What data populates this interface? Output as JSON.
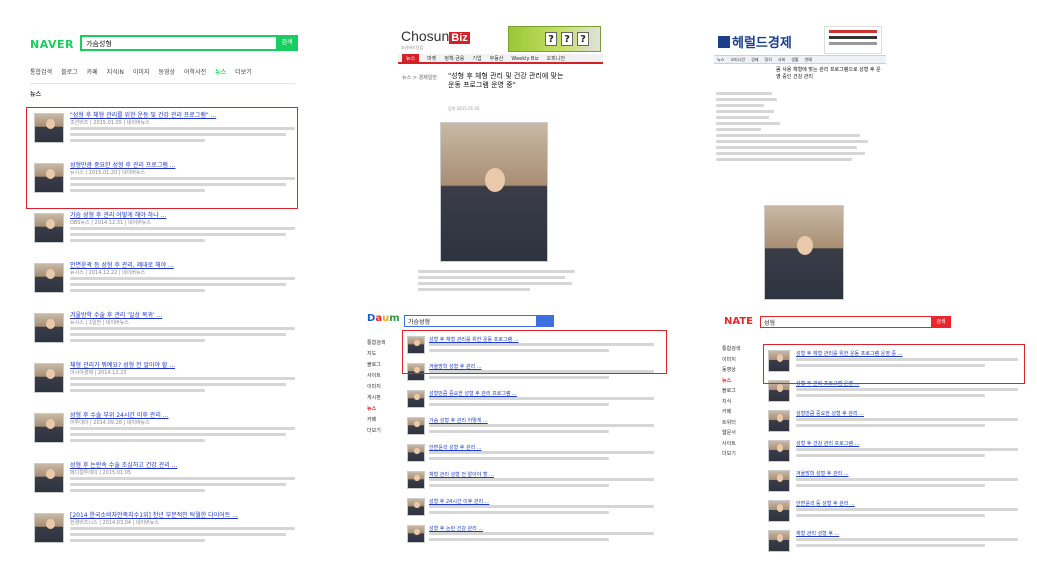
{
  "naver": {
    "logo": "NAVER",
    "search_value": "가슴성형",
    "search_button": "검색",
    "tabs": [
      "통합검색",
      "블로그",
      "카페",
      "지식iN",
      "이미지",
      "동영상",
      "어학사전",
      "뉴스",
      "더보기"
    ],
    "active_tab": "뉴스",
    "section_label": "뉴스",
    "results": [
      {
        "title": "\"성형 후 체형 관리를 위한 운동 및 건강 관리 프로그램\" ...",
        "meta": "조선비즈 | 2015.01.05 | 네이버뉴스"
      },
      {
        "title": "성형만큼 중요한 성형 후 관리 프로그램 ...",
        "meta": "뉴시스 | 2015.01.20 | 네이버뉴스"
      },
      {
        "title": "가슴 성형 후 관리 어떻게 해야 하나 ...",
        "meta": "OBS뉴스 | 2014.12.31 | 네이버뉴스"
      },
      {
        "title": "안면윤곽 등 성형 후 관리, 제대로 해야 ...",
        "meta": "뉴시스 | 2014.12.22 | 네이버뉴스"
      },
      {
        "title": "겨울방학 수술 후 관리 '일상 복귀' ...",
        "meta": "뉴시스 | 1일전 | 네이버뉴스"
      },
      {
        "title": "체형 관리가 뭐예요? 성형 전 알아야 할 ...",
        "meta": "아시아경제 | 2014.12.23"
      },
      {
        "title": "성형 후 수술 부위 24시간 이후 관리 ...",
        "meta": "이투데이 | 2014.09.28 | 네이버뉴스"
      },
      {
        "title": "성형 후 논란속 수술 조심하고 건강 관리 ...",
        "meta": "메디컬투데이 | 2015.01.05"
      },
      {
        "title": "[2014 한국소비자만족지수1위] 천년 부분적인 탁월한 다이어트 ...",
        "meta": "한경비즈니스 | 2014.03.04 | 네이버뉴스"
      }
    ]
  },
  "chosun": {
    "logo_prefix": "Chosun",
    "logo_suffix": "Biz",
    "logo_sub": "조선비즈닷컴",
    "ad_marks": [
      "?",
      "?",
      "?"
    ],
    "nav": [
      "뉴스",
      "마켓",
      "정책·금융",
      "기업",
      "부동산",
      "Weekly Biz",
      "오피니언"
    ],
    "active_nav": "뉴스",
    "category": "뉴스 > 경제일반",
    "headline": "\"성형 후 체형 관리 및 건강 관리에 맞는 운동 프로그램 운영 중\"",
    "date": "입력 2015.01.05"
  },
  "herald": {
    "logo": "헤럴드경제",
    "nav": [
      "뉴스",
      "오피니언",
      "경제",
      "정치",
      "사회",
      "생활",
      "연예"
    ],
    "headline": "몸 사용 체형에 맞는 관리 프로그램으로 성형 후 운영 중인 건강 관리"
  },
  "daum": {
    "logo": "Daum",
    "logo_colors": [
      "#1e5bd6",
      "#e8262b",
      "#f3a81b",
      "#2e9d3f"
    ],
    "search_value": "가슴성형",
    "side": [
      "통합검색",
      "지도",
      "블로그",
      "사이트",
      "이미지",
      "게시판",
      "뉴스",
      "카페",
      "더보기"
    ],
    "active_side": "뉴스",
    "results": [
      {
        "title": "성형 후 체형 관리를 위한 운동 프로그램 ..."
      },
      {
        "title": "겨울방학 성형 후 관리 ..."
      },
      {
        "title": "성형만큼 중요한 성형 후 관리 프로그램 ..."
      },
      {
        "title": "가슴 성형 후 관리 어떻게 ..."
      },
      {
        "title": "안면윤곽 성형 후 관리 ..."
      },
      {
        "title": "체형 관리 성형 전 알아야 할 ..."
      },
      {
        "title": "성형 후 24시간 이후 관리 ..."
      },
      {
        "title": "성형 후 논란 건강 관리 ..."
      }
    ]
  },
  "nate": {
    "logo": "NATE",
    "search_value": "성형",
    "search_button": "검색",
    "side": [
      "통합검색",
      "이미지",
      "동영상",
      "뉴스",
      "블로그",
      "지식",
      "카페",
      "트위터",
      "웹문서",
      "사이트",
      "더보기"
    ],
    "active_side": "뉴스",
    "results": [
      {
        "title": "성형 후 체형 관리를 위한 운동 프로그램 운영 중 ..."
      },
      {
        "title": "성형 후 관리 프로그램 운영 ..."
      },
      {
        "title": "성형만큼 중요한 성형 후 관리 ..."
      },
      {
        "title": "성형 후 건강 관리 프로그램 ..."
      },
      {
        "title": "겨울방학 성형 후 관리 ..."
      },
      {
        "title": "안면윤곽 등 성형 후 관리 ..."
      },
      {
        "title": "체형 관리 성형 후 ..."
      }
    ]
  },
  "colors": {
    "naver_green": "#19ce60",
    "highlight_red": "#d9232e",
    "link_blue": "#2136c0"
  }
}
